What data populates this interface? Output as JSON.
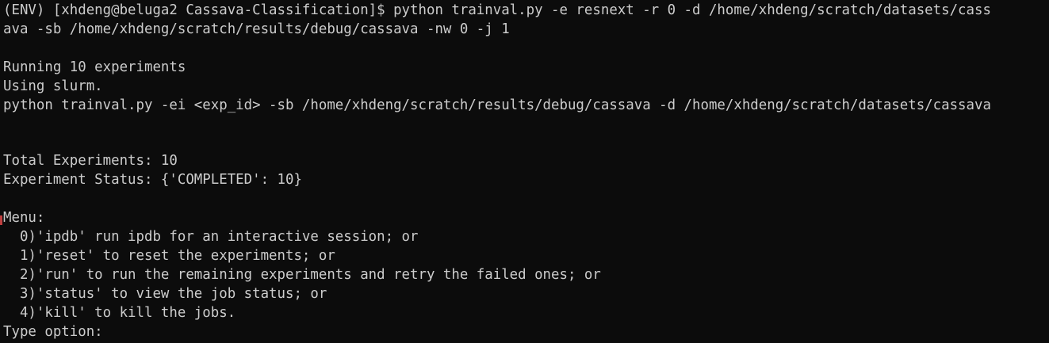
{
  "terminal": {
    "command_line_1": "(ENV) [xhdeng@beluga2 Cassava-Classification]$ python trainval.py -e resnext -r 0 -d /home/xhdeng/scratch/datasets/cass",
    "command_line_2": "ava -sb /home/xhdeng/scratch/results/debug/cassava -nw 0 -j 1",
    "running": "Running 10 experiments",
    "using": "Using slurm.",
    "example_command": "python trainval.py -ei <exp_id> -sb /home/xhdeng/scratch/results/debug/cassava -d /home/xhdeng/scratch/datasets/cassava",
    "total_experiments": "Total Experiments: 10",
    "experiment_status": "Experiment Status: {'COMPLETED': 10}",
    "menu_title": "Menu:",
    "menu_items": [
      "  0)'ipdb' run ipdb for an interactive session; or",
      "  1)'reset' to reset the experiments; or",
      "  2)'run' to run the remaining experiments and retry the failed ones; or",
      "  3)'status' to view the job status; or",
      "  4)'kill' to kill the jobs."
    ],
    "prompt": "Type option: "
  },
  "colors": {
    "background": "#0c0c0c",
    "foreground": "#cccccc"
  }
}
